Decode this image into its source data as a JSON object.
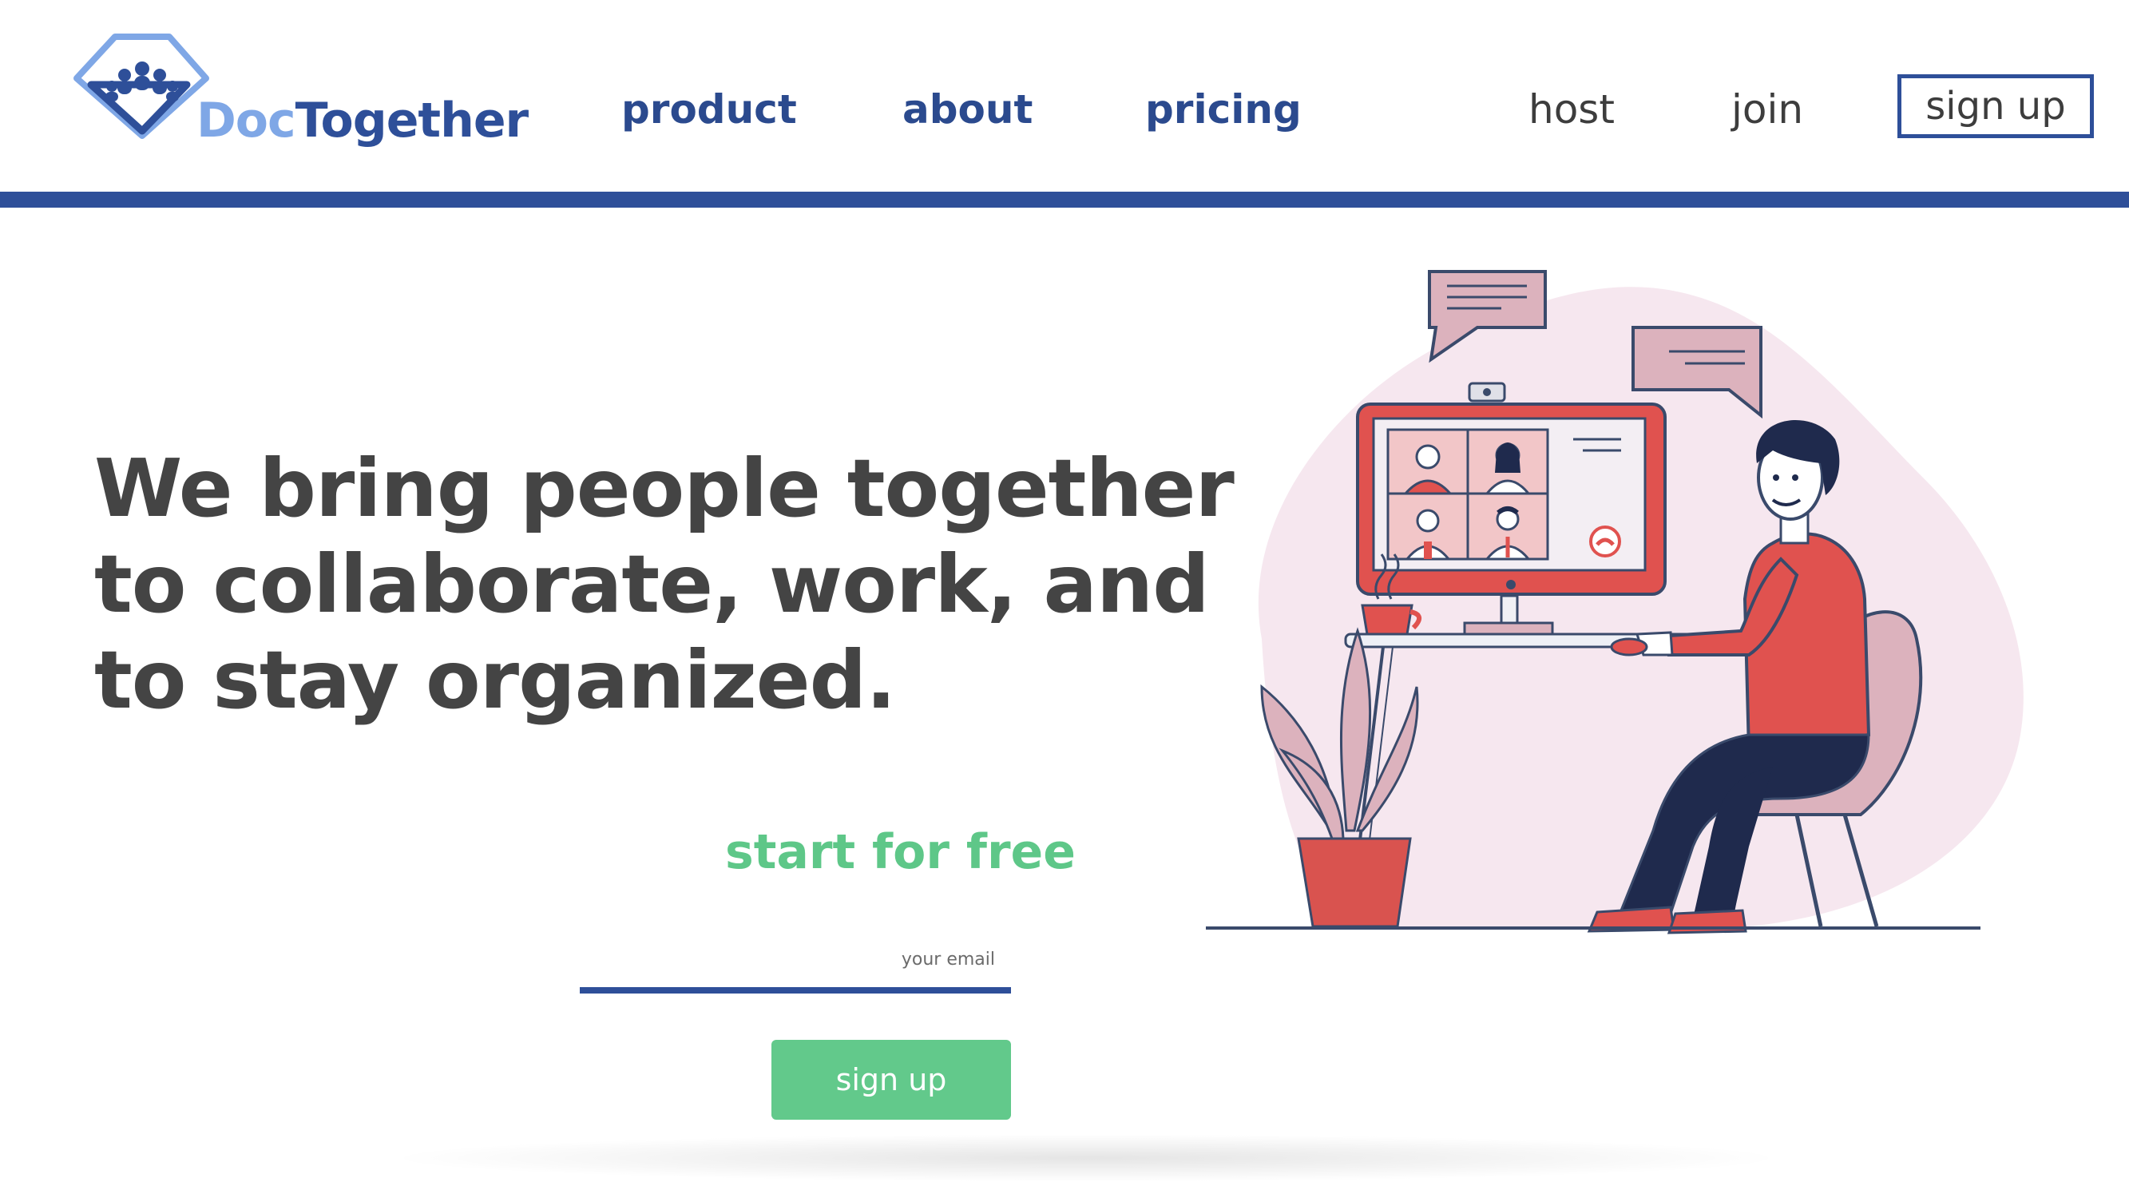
{
  "brand": {
    "name_part1": "Doc",
    "name_part2": "Together",
    "color_primary": "#2e4f99",
    "color_light": "#7fa7e6"
  },
  "nav": {
    "product": "product",
    "about": "about",
    "pricing": "pricing",
    "host": "host",
    "join": "join",
    "signup": "sign up"
  },
  "hero": {
    "headline_line1": "We bring people together",
    "headline_line2": "to collaborate, work, and",
    "headline_line3": "to stay organized.",
    "cta_heading": "start for free",
    "email_placeholder": "your email",
    "email_value": "",
    "signup_button": "sign up",
    "accent_green": "#5ec788"
  },
  "illustration": {
    "icons": [
      "video-call-monitor-icon",
      "chat-bubble-icon",
      "coffee-cup-icon",
      "potted-plant-icon",
      "end-call-icon"
    ]
  }
}
